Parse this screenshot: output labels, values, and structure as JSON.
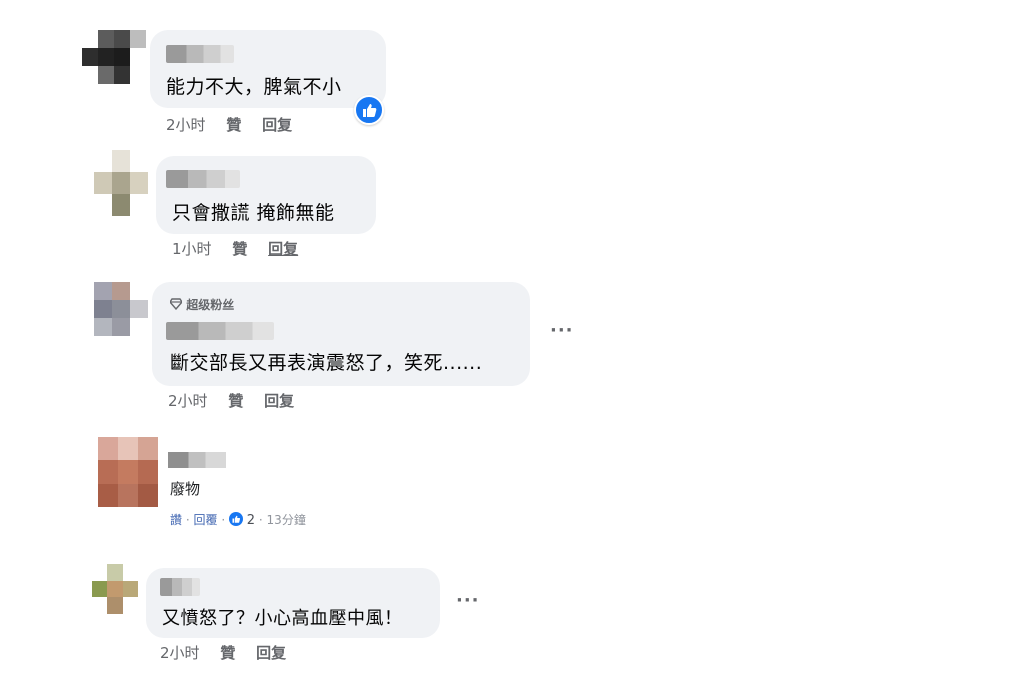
{
  "comments": [
    {
      "text": "能力不大，脾氣不小",
      "time": "2小时",
      "like": "贊",
      "reply": "回复"
    },
    {
      "text": "只會撒謊 掩飾無能",
      "time": "1小时",
      "like": "贊",
      "reply": "回复"
    },
    {
      "badge": "超级粉丝",
      "text": "斷交部長又再表演震怒了，笑死......",
      "time": "2小时",
      "like": "贊",
      "reply": "回复"
    },
    {
      "text": "廢物",
      "like": "讚",
      "reply": "回覆",
      "reaction_count": "2",
      "time": "13分鐘"
    },
    {
      "text": "又憤怒了？小心高血壓中風！",
      "time": "2小时",
      "like": "贊",
      "reply": "回复"
    }
  ],
  "icons": {
    "like_reaction": "thumbs-up-icon",
    "more": "more-options-icon",
    "fan_badge": "diamond-icon"
  },
  "colors": {
    "bubble": "#f0f2f5",
    "like_blue": "#1877f2",
    "link_blue": "#4267b2"
  }
}
